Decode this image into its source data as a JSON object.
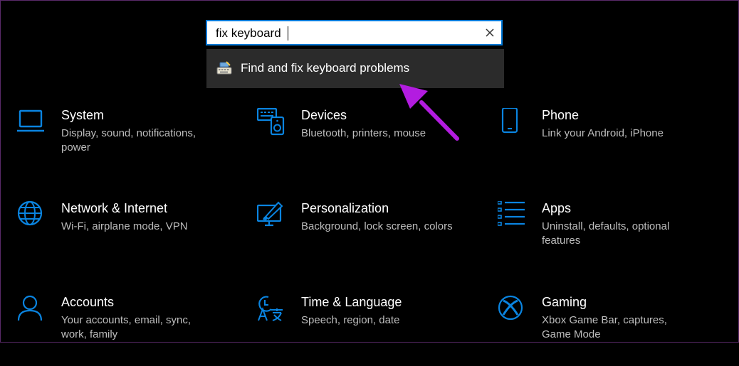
{
  "search": {
    "value": "fix keyboard",
    "clear_icon": "close-icon"
  },
  "suggestions": [
    {
      "label": "Find and fix keyboard problems",
      "icon": "keyboard-troubleshoot-icon"
    }
  ],
  "tiles": [
    {
      "title": "System",
      "description": "Display, sound, notifications, power",
      "icon": "laptop-icon"
    },
    {
      "title": "Devices",
      "description": "Bluetooth, printers, mouse",
      "icon": "devices-icon"
    },
    {
      "title": "Phone",
      "description": "Link your Android, iPhone",
      "icon": "phone-icon"
    },
    {
      "title": "Network & Internet",
      "description": "Wi-Fi, airplane mode, VPN",
      "icon": "globe-icon"
    },
    {
      "title": "Personalization",
      "description": "Background, lock screen, colors",
      "icon": "paint-brush-icon"
    },
    {
      "title": "Apps",
      "description": "Uninstall, defaults, optional features",
      "icon": "apps-list-icon"
    },
    {
      "title": "Accounts",
      "description": "Your accounts, email, sync, work, family",
      "icon": "person-icon"
    },
    {
      "title": "Time & Language",
      "description": "Speech, region, date",
      "icon": "time-language-icon"
    },
    {
      "title": "Gaming",
      "description": "Xbox Game Bar, captures, Game Mode",
      "icon": "xbox-icon"
    }
  ],
  "colors": {
    "accent": "#0078d7",
    "annotation_arrow": "#b31ce0",
    "dropdown_bg": "#2b2b2b",
    "description_text": "#bdbdbd"
  }
}
